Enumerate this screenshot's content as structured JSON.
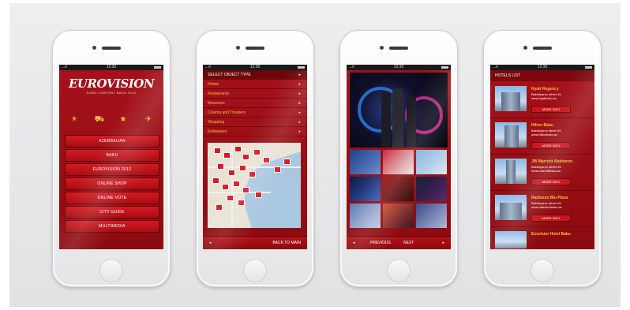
{
  "colors": {
    "brand_red": "#a6111a",
    "accent_gold": "#f5c040"
  },
  "status": {
    "carrier": "...ıl ⁀",
    "time": "12:30"
  },
  "phone1": {
    "logo_word": "EUROVISION",
    "logo_sub": "SONG CONTEST BAKU 2012",
    "icons": [
      "sun-icon",
      "car-icon",
      "star-icon",
      "plane-icon"
    ],
    "menu": [
      "AZERBAIJAN",
      "BAKU",
      "EUROVISION 2012",
      "ONLINE SHOP",
      "ONLINE VOTE",
      "CITY GUIDE",
      "MULTIMEDIA"
    ]
  },
  "phone2": {
    "header": "SELECT OBJECT TYPE",
    "items": [
      "Hotels",
      "Restaurants",
      "Museums",
      "Cinema and Theaters",
      "Shopping",
      "Embassies"
    ],
    "back_label": "BACK TO MAIN"
  },
  "phone3": {
    "prev_label": "PREVIOUS",
    "next_label": "NEXT"
  },
  "phone4": {
    "header": "HOTELS LIST",
    "more_label": "MORE INFO",
    "hotels": [
      {
        "name": "Hyatt Regency",
        "address": "Bakhtiyarov street 45",
        "url": "www.hyattbaku.az"
      },
      {
        "name": "Hilton Baku",
        "address": "Bakhtiyarov street 45",
        "url": "www.hiltonbaku.az"
      },
      {
        "name": "JW Marriott Absheron",
        "address": "Bakhtiyarov street 45",
        "url": "www.marriottbaku.az"
      },
      {
        "name": "Radisson Blu Plaza",
        "address": "Bakhtiyarov street 45",
        "url": "www.radissonbaku.az"
      },
      {
        "name": "Excelsior Hotel Baku",
        "address": "",
        "url": ""
      }
    ]
  }
}
